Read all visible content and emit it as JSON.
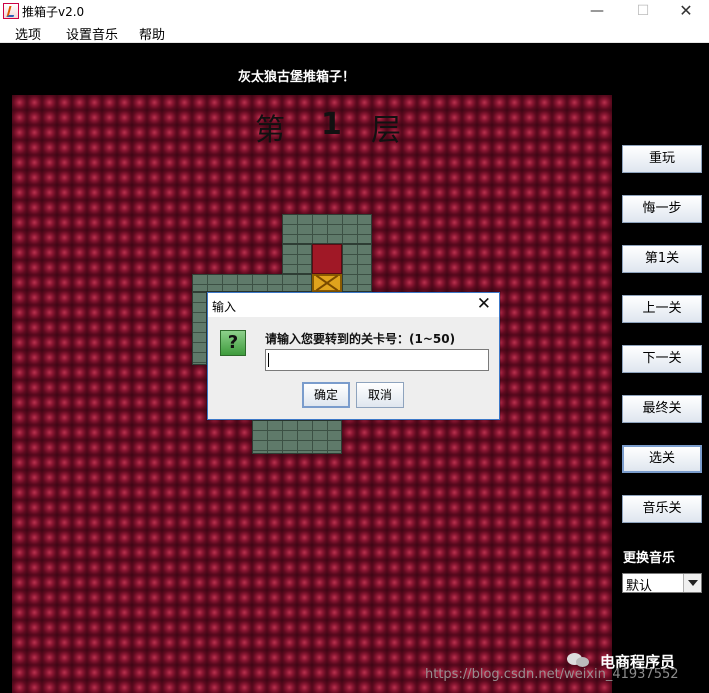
{
  "window": {
    "title": "推箱子v2.0",
    "controls": {
      "minimize": "—",
      "maximize": "☐",
      "close": "✕"
    }
  },
  "menubar": {
    "items": [
      {
        "label": "选项"
      },
      {
        "label": "设置音乐"
      },
      {
        "label": "帮助"
      }
    ]
  },
  "game": {
    "heading": "灰太狼古堡推箱子！",
    "level_title": {
      "prefix": "第",
      "number": "1",
      "suffix": "层"
    }
  },
  "sidebar": {
    "buttons": [
      {
        "label": "重玩"
      },
      {
        "label": "悔一步"
      },
      {
        "label": "第1关"
      },
      {
        "label": "上一关"
      },
      {
        "label": "下一关"
      },
      {
        "label": "最终关"
      },
      {
        "label": "选关"
      },
      {
        "label": "音乐关"
      }
    ],
    "music_label": "更换音乐",
    "music_select": {
      "value": "默认"
    }
  },
  "dialog": {
    "title": "输入",
    "close": "✕",
    "icon": "?",
    "message": "请输入您要转到的关卡号：(1~50)",
    "input_value": "",
    "ok_label": "确定",
    "cancel_label": "取消"
  },
  "watermark": {
    "brand": "电商程序员",
    "url": "https://blog.csdn.net/weixin_41937552"
  },
  "colors": {
    "board_red": "#6d0f26",
    "wall_green": "#5f7a6a",
    "crate_gold": "#e0a31d",
    "dialog_border": "#3c78c8"
  }
}
